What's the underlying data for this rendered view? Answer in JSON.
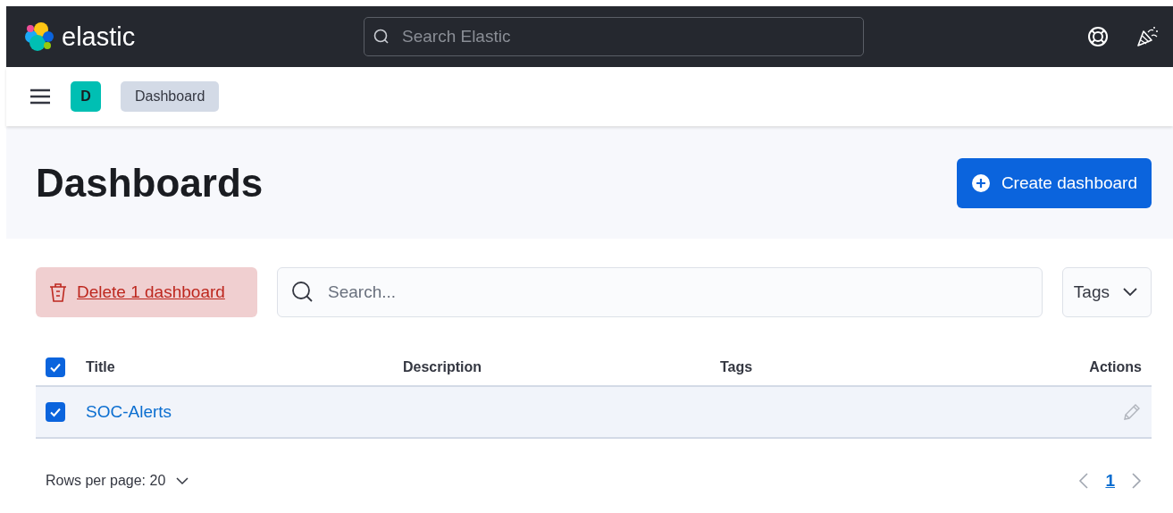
{
  "header": {
    "logo_text": "elastic",
    "search": {
      "placeholder": "Search Elastic"
    }
  },
  "breadcrumb": {
    "space_avatar": "D",
    "items": [
      {
        "label": "Dashboard"
      }
    ]
  },
  "page": {
    "title": "Dashboards",
    "create_button": "Create dashboard"
  },
  "toolbar": {
    "delete_button": "Delete 1 dashboard",
    "search": {
      "placeholder": "Search..."
    },
    "tags_filter": "Tags"
  },
  "table": {
    "all_selected": true,
    "columns": [
      "Title",
      "Description",
      "Tags",
      "Actions"
    ],
    "rows": [
      {
        "title": "SOC-Alerts",
        "selected": true
      }
    ]
  },
  "pagination": {
    "rows_per_page": "Rows per page: 20",
    "pages": [
      {
        "label": "1",
        "selected": true
      }
    ]
  }
}
